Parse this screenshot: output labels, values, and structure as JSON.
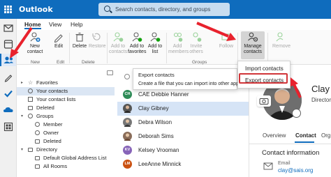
{
  "app": {
    "name": "Outlook"
  },
  "search": {
    "placeholder": "Search contacts, directory, and groups"
  },
  "tabs": [
    "Home",
    "View",
    "Help"
  ],
  "ribbon": {
    "new_contact": "New contact",
    "edit": "Edit",
    "delete": "Delete",
    "restore": "Restore",
    "add_to_contacts": "Add to contacts",
    "add_to_favorites": "Add to favorites",
    "add_to_list": "Add to list",
    "add_members": "Add members",
    "invite_others": "Invite others",
    "follow": "Follow",
    "manage_contacts": "Manage contacts",
    "remove": "Remove",
    "groups": {
      "new": "New",
      "edit": "Edit",
      "delete": "Delete",
      "groups": "Groups"
    }
  },
  "dropdown": {
    "import": "Import contacts",
    "export": "Export contacts"
  },
  "tooltip": {
    "title": "Export contacts",
    "description": "Create a file that you can import into other apps."
  },
  "folders": {
    "favorites": "Favorites",
    "your_contacts": "Your contacts",
    "your_contact_lists": "Your contact lists",
    "deleted": "Deleted",
    "groups": "Groups",
    "member": "Member",
    "owner": "Owner",
    "groups_deleted": "Deleted",
    "directory": "Directory",
    "default_gal": "Default Global Address List",
    "all_rooms": "All Rooms"
  },
  "contacts": [
    {
      "initials": "CH",
      "name": "CAE Debbie Hanner",
      "color": "#2e8b57"
    },
    {
      "initials": "",
      "name": "Clay Gibney",
      "color": "#555555"
    },
    {
      "initials": "",
      "name": "Debra Wilson",
      "color": "#777777"
    },
    {
      "initials": "",
      "name": "Deborah Sims",
      "color": "#8a6d5a"
    },
    {
      "initials": "KV",
      "name": "Kelsey Vrooman",
      "color": "#8764b8"
    },
    {
      "initials": "LM",
      "name": "LeeAnne Minnick",
      "color": "#ca5010"
    }
  ],
  "detail": {
    "name": "Clay",
    "title": "Director",
    "tabs": [
      "Overview",
      "Contact",
      "Org"
    ],
    "section": "Contact information",
    "email_label": "Email",
    "email": "clay@sais.org"
  },
  "colors": {
    "brand": "#0f6cbd",
    "arrow": "#e8222d"
  }
}
